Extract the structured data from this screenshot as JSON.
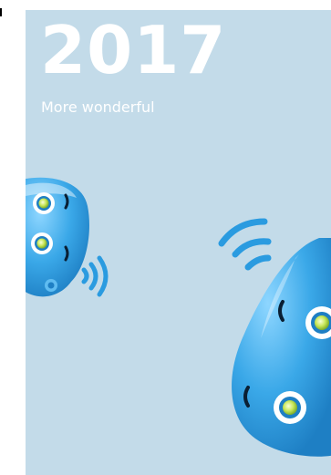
{
  "poster": {
    "year": "2017",
    "tagline": "More wonderful",
    "background_color": "#c3dbe9",
    "accent_color": "#3aa8e8"
  },
  "icons": {
    "left_robot": "robot-head-icon",
    "right_robot": "robot-head-icon",
    "signal_left": "wifi-signal-icon",
    "signal_right": "wifi-signal-icon"
  }
}
